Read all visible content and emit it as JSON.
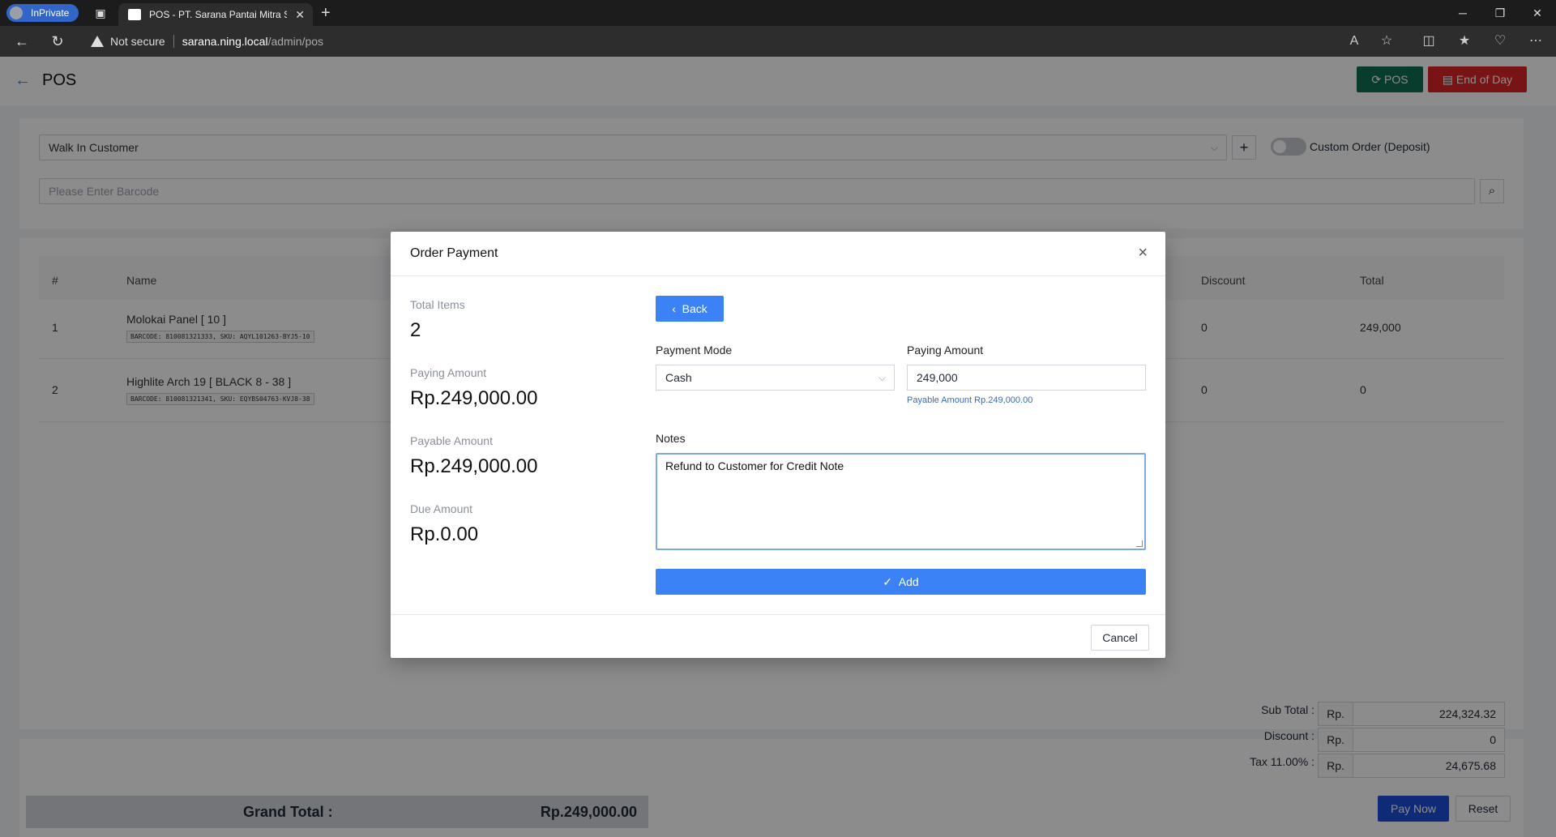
{
  "browser": {
    "inprivate_label": "InPrivate",
    "tab_title": "POS - PT. Sarana Pantai Mitra Se",
    "security_label": "Not secure",
    "url_host": "sarana.ning.local",
    "url_path": "/admin/pos"
  },
  "header": {
    "title": "POS",
    "pos_button": "POS",
    "end_of_day_button": "End of Day"
  },
  "customer": {
    "selected": "Walk In Customer",
    "add_symbol": "+",
    "custom_order_label": "Custom Order (Deposit)"
  },
  "barcode": {
    "placeholder": "Please Enter Barcode"
  },
  "table": {
    "headers": {
      "index": "#",
      "name": "Name",
      "discount": "Discount",
      "total": "Total"
    },
    "rows": [
      {
        "index": "1",
        "name": "Molokai Panel [ 10 ]",
        "meta": "BARCODE: 810081321333, SKU: AQYL101263-BYJ5-10",
        "discount": "0",
        "total": "249,000"
      },
      {
        "index": "2",
        "name": "Highlite Arch 19 [ BLACK 8 - 38 ]",
        "meta": "BARCODE: 810081321341, SKU: EQYBS04763-KVJ8-38",
        "discount": "0",
        "total": "0"
      }
    ]
  },
  "totals": {
    "subtotal_label": "Sub Total :",
    "discount_label": "Discount :",
    "tax_label": "Tax 11.00% :",
    "currency": "Rp.",
    "subtotal": "224,324.32",
    "discount": "0",
    "tax": "24,675.68",
    "grand_label": "Grand Total :",
    "grand_value": "Rp.249,000.00",
    "pay_now": "Pay Now",
    "reset": "Reset"
  },
  "modal": {
    "title": "Order Payment",
    "close_symbol": "×",
    "total_items_label": "Total Items",
    "total_items": "2",
    "paying_amount_label": "Paying Amount",
    "paying_amount": "Rp.249,000.00",
    "payable_amount_label": "Payable Amount",
    "payable_amount": "Rp.249,000.00",
    "due_amount_label": "Due Amount",
    "due_amount": "Rp.0.00",
    "back_button": "Back",
    "payment_mode_label": "Payment Mode",
    "payment_mode": "Cash",
    "paying_input_label": "Paying Amount",
    "paying_input_value": "249,000",
    "payable_hint": "Payable Amount Rp.249,000.00",
    "notes_label": "Notes",
    "notes_value": "Refund to Customer for Credit Note",
    "add_button": "Add",
    "cancel_button": "Cancel"
  }
}
